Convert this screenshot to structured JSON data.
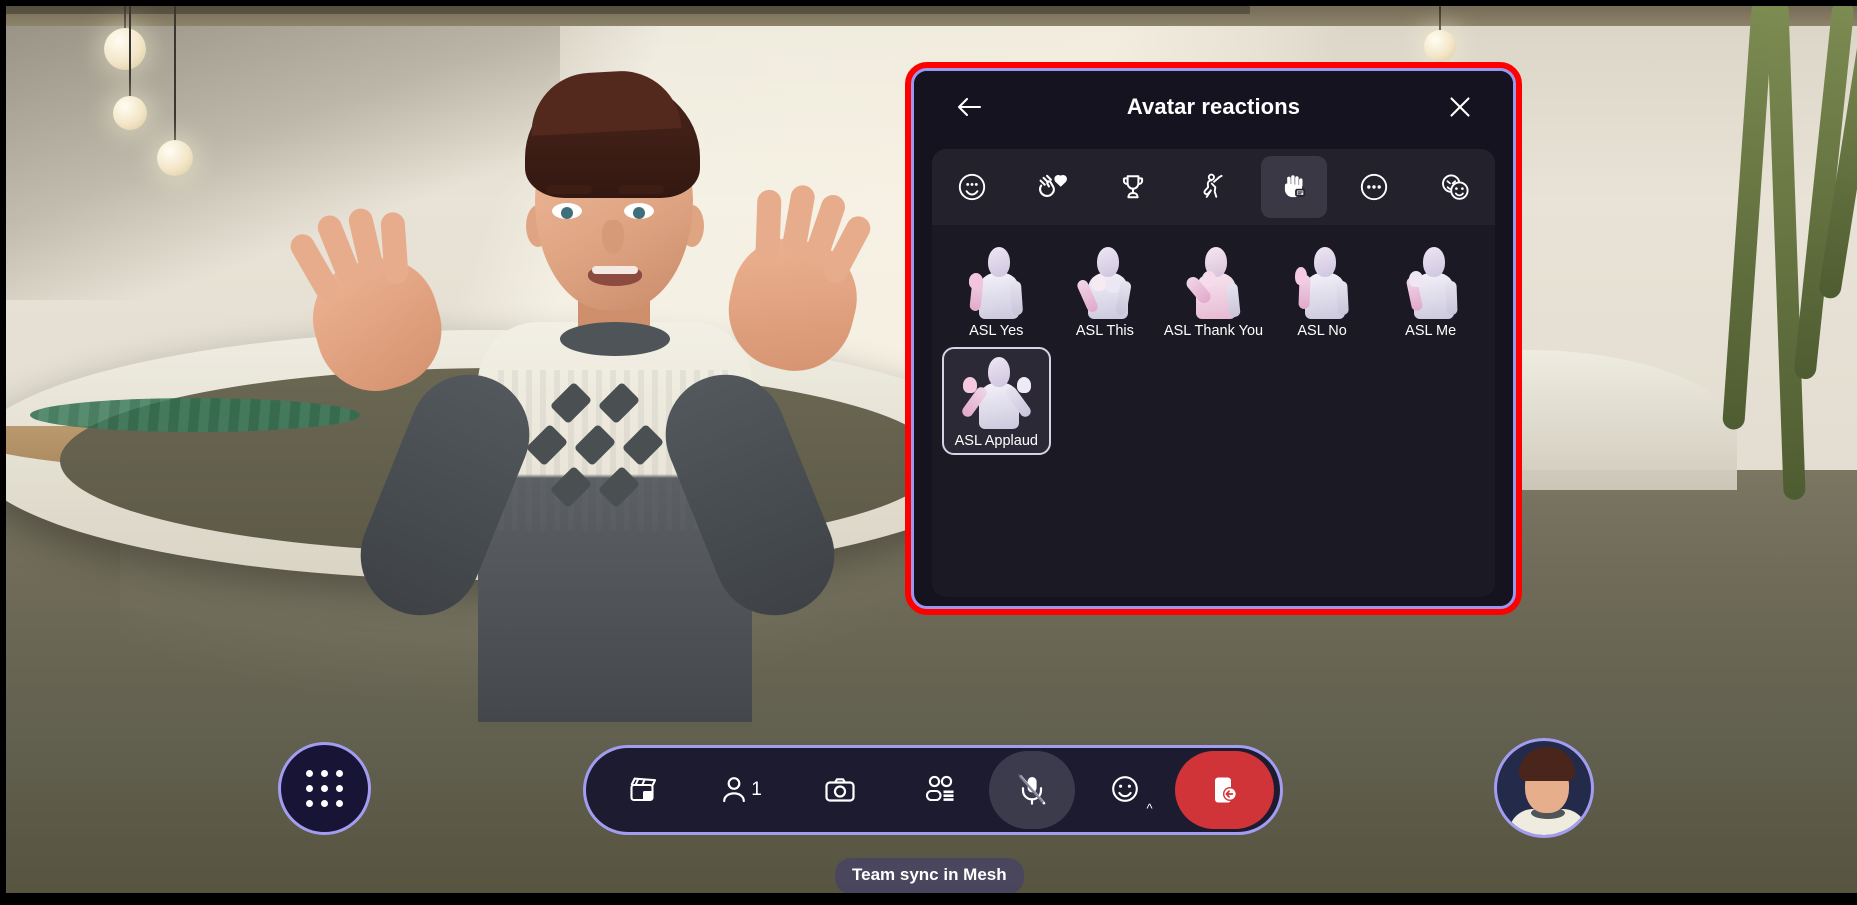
{
  "app": {
    "meeting_label": "Team sync in Mesh"
  },
  "panel": {
    "title": "Avatar reactions",
    "back_icon": "arrow-left-icon",
    "close_icon": "close-icon",
    "highlight_color": "#ff0000",
    "border_color": "#9b96f0",
    "background": "#14131f",
    "tabs": [
      {
        "id": "emoji",
        "icon": "smiley-icon",
        "selected": false
      },
      {
        "id": "applause",
        "icon": "clap-heart-icon",
        "selected": false
      },
      {
        "id": "celebrate",
        "icon": "trophy-icon",
        "selected": false
      },
      {
        "id": "dance",
        "icon": "dancing-person-icon",
        "selected": false
      },
      {
        "id": "sign-language",
        "icon": "raised-hand-icon",
        "selected": true
      },
      {
        "id": "more",
        "icon": "more-horizontal-icon",
        "selected": false
      },
      {
        "id": "custom",
        "icon": "double-emoji-icon",
        "selected": false
      }
    ],
    "reactions": [
      {
        "label": "ASL Yes",
        "pose": "yes",
        "focused": false,
        "tone": "light"
      },
      {
        "label": "ASL This",
        "pose": "this",
        "focused": false,
        "tone": "light"
      },
      {
        "label": "ASL Thank You",
        "pose": "thankyou",
        "focused": false,
        "tone": "pink"
      },
      {
        "label": "ASL No",
        "pose": "no",
        "focused": false,
        "tone": "light"
      },
      {
        "label": "ASL Me",
        "pose": "me",
        "focused": false,
        "tone": "light"
      },
      {
        "label": "ASL Applaud",
        "pose": "applaud",
        "focused": true,
        "tone": "light"
      }
    ]
  },
  "toolbar": {
    "apps_icon": "grid-apps-icon",
    "buttons": [
      {
        "id": "immersive",
        "icon": "clapperboard-icon",
        "label": "",
        "state": "default"
      },
      {
        "id": "participants",
        "icon": "person-icon",
        "label": "1",
        "state": "default"
      },
      {
        "id": "camera",
        "icon": "camera-icon",
        "label": "",
        "state": "default"
      },
      {
        "id": "view",
        "icon": "gallery-view-icon",
        "label": "",
        "state": "default"
      },
      {
        "id": "microphone",
        "icon": "mic-off-icon",
        "label": "",
        "state": "active"
      },
      {
        "id": "reactions",
        "icon": "smiley-chevron-icon",
        "label": "",
        "state": "default"
      },
      {
        "id": "leave",
        "icon": "leave-door-icon",
        "label": "",
        "state": "leave"
      }
    ],
    "self_avatar": "self-avatar-thumbnail"
  }
}
